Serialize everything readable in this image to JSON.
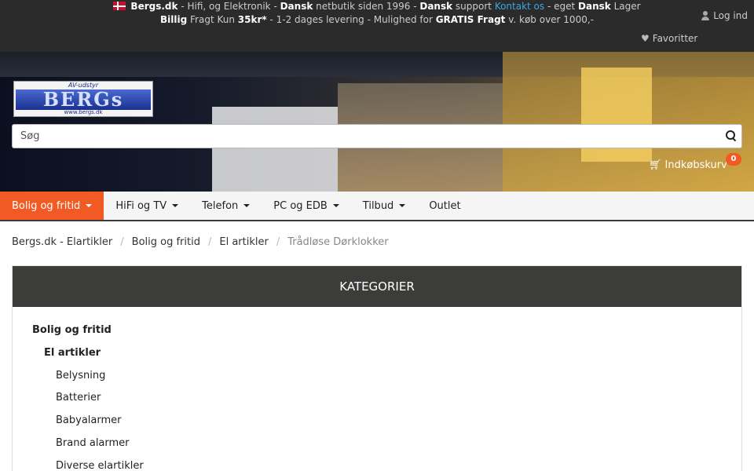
{
  "topbar": {
    "promo_line1": [
      {
        "t": "Bergs.dk",
        "b": true
      },
      {
        "t": " - Hifi, og Elektronik - ",
        "b": false
      },
      {
        "t": "Dansk",
        "b": true
      },
      {
        "t": " netbutik siden 1996 - ",
        "b": false
      },
      {
        "t": "Dansk",
        "b": true
      },
      {
        "t": " support ",
        "b": false
      },
      {
        "t": "Kontakt os",
        "link": true
      },
      {
        "t": " - eget ",
        "b": false
      },
      {
        "t": "Dansk",
        "b": true
      },
      {
        "t": " Lager",
        "b": false
      }
    ],
    "promo_line2": [
      {
        "t": "Billig",
        "b": true
      },
      {
        "t": " Fragt Kun ",
        "b": false
      },
      {
        "t": "35kr*",
        "b": true
      },
      {
        "t": "  - 1-2 dages levering - Mulighed for ",
        "b": false
      },
      {
        "t": "GRATIS Fragt",
        "b": true
      },
      {
        "t": " v. køb over 1000,-",
        "b": false
      }
    ],
    "login_label": "Log ind",
    "favorites_label": "Favoritter"
  },
  "logo": {
    "top": "AV-udstyr",
    "main": "BERGs",
    "bottom": "www.bergs.dk"
  },
  "search": {
    "placeholder": "Søg"
  },
  "cart": {
    "label": "Indkøbskurv",
    "count": "0"
  },
  "nav": {
    "items": [
      {
        "label": "Bolig og fritid",
        "dropdown": true,
        "active": true
      },
      {
        "label": "HiFi og TV",
        "dropdown": true
      },
      {
        "label": "Telefon",
        "dropdown": true
      },
      {
        "label": "PC og EDB",
        "dropdown": true
      },
      {
        "label": "Tilbud",
        "dropdown": true
      },
      {
        "label": "Outlet",
        "dropdown": false
      }
    ]
  },
  "breadcrumb": {
    "items": [
      "Bergs.dk - Elartikler",
      "Bolig og fritid",
      "El artikler"
    ],
    "current": "Trådløse Dørklokker"
  },
  "categories": {
    "title": "KATEGORIER",
    "items": [
      {
        "label": "Bolig og fritid",
        "level": 0
      },
      {
        "label": "El artikler",
        "level": 1
      },
      {
        "label": "Belysning",
        "level": 2
      },
      {
        "label": "Batterier",
        "level": 2
      },
      {
        "label": "Babyalarmer",
        "level": 2
      },
      {
        "label": "Brand alarmer",
        "level": 2
      },
      {
        "label": "Diverse elartikler",
        "level": 2
      }
    ]
  },
  "colors": {
    "accent": "#f15a24",
    "topbar": "#2b2b2b",
    "link": "#3aa6e8",
    "category_header": "#3c3c3a"
  }
}
